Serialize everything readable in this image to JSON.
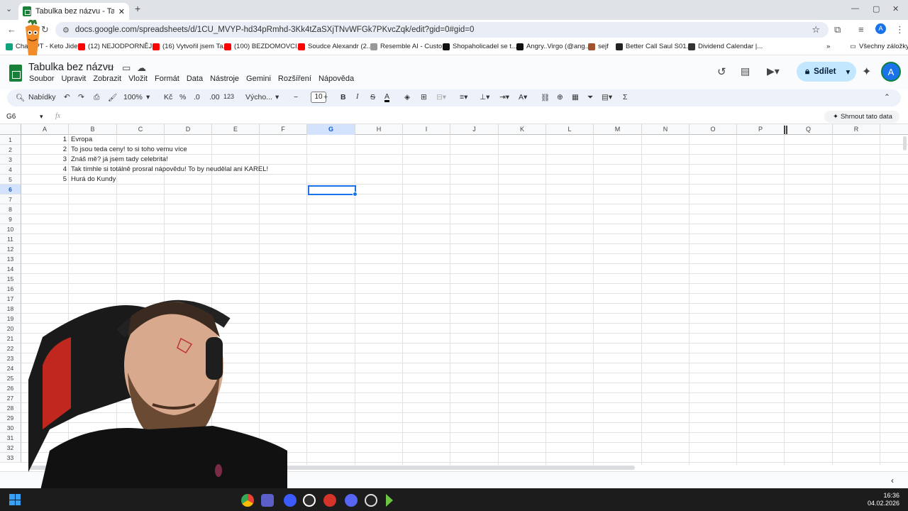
{
  "browser": {
    "tab_title": "Tabulka bez názvu - Tabulky Go",
    "url": "docs.google.com/spreadsheets/d/1CU_MVYP-hd34pRmhd-3Kk4tZaSXjTNvWFGk7PKvcZqk/edit?gid=0#gid=0",
    "bookmarks": [
      {
        "label": "ChatGPT - Keto Jide...",
        "color": "#10a37f"
      },
      {
        "label": "(12) NEJODPORNĚJ...",
        "color": "#ff0000"
      },
      {
        "label": "(16) Vytvořil jsem Ta...",
        "color": "#ff0000"
      },
      {
        "label": "(100) BEZDOMOVCI...",
        "color": "#ff0000"
      },
      {
        "label": "Soudce Alexandr (2...",
        "color": "#ff0000"
      },
      {
        "label": "Resemble AI - Custo...",
        "color": "#999999"
      },
      {
        "label": "Shopaholicadel se t...",
        "color": "#111111"
      },
      {
        "label": "Angry..Virgo (@ang...",
        "color": "#111111"
      },
      {
        "label": "sejf",
        "color": "#a0522d"
      },
      {
        "label": "Better Call Saul S01...",
        "color": "#222222"
      },
      {
        "label": "Dividend Calendar |...",
        "color": "#333333"
      }
    ],
    "all_bookmarks": "Všechny záložky"
  },
  "app": {
    "doc_name": "Tabulka bez názvu",
    "menu": [
      "Soubor",
      "Upravit",
      "Zobrazit",
      "Vložit",
      "Formát",
      "Data",
      "Nástroje",
      "Gemini",
      "Rozšíření",
      "Nápověda"
    ],
    "share_label": "Sdílet",
    "avatar_letter": "A",
    "accent": "#1a73e8"
  },
  "toolbar": {
    "search_label": "Nabídky",
    "zoom": "100%",
    "currency": "Kč",
    "percent": "%",
    "dec_minus": ".0",
    "dec_plus": ".00",
    "format_num": "123",
    "font": "Výcho...",
    "font_size": "10",
    "minus": "−",
    "plus": "+",
    "bold": "B",
    "italic": "I",
    "strike": "S",
    "textcolor": "A"
  },
  "formula_bar": {
    "name_box": "G6",
    "fx": "fx",
    "summarize": "Shrnout tato data"
  },
  "grid": {
    "columns": [
      "A",
      "B",
      "C",
      "D",
      "E",
      "F",
      "G",
      "H",
      "I",
      "J",
      "K",
      "L",
      "M",
      "N",
      "O",
      "P",
      "Q",
      "R"
    ],
    "selected_column": "G",
    "selected_row": "6",
    "rows": [
      "1",
      "2",
      "3",
      "4",
      "5",
      "6",
      "7",
      "8",
      "9",
      "10",
      "11",
      "12",
      "13",
      "14",
      "15",
      "16",
      "17",
      "18",
      "19",
      "20",
      "21",
      "22",
      "23",
      "24",
      "25",
      "26",
      "27",
      "28",
      "29",
      "30",
      "31",
      "32",
      "33"
    ],
    "cells_a": [
      "1",
      "2",
      "3",
      "4",
      "5"
    ],
    "cells_b": [
      "Evropa",
      "To jsou teda ceny! to si toho vemu více",
      "Znáš mě? já jsem tady celebrita!",
      "Tak tímhle si totálně prosral nápovědu! To by neudělal ani KAREL!",
      "Hurá do Kundy"
    ]
  },
  "taskbar": {
    "time": "16:36",
    "date": "04.02.2026"
  }
}
